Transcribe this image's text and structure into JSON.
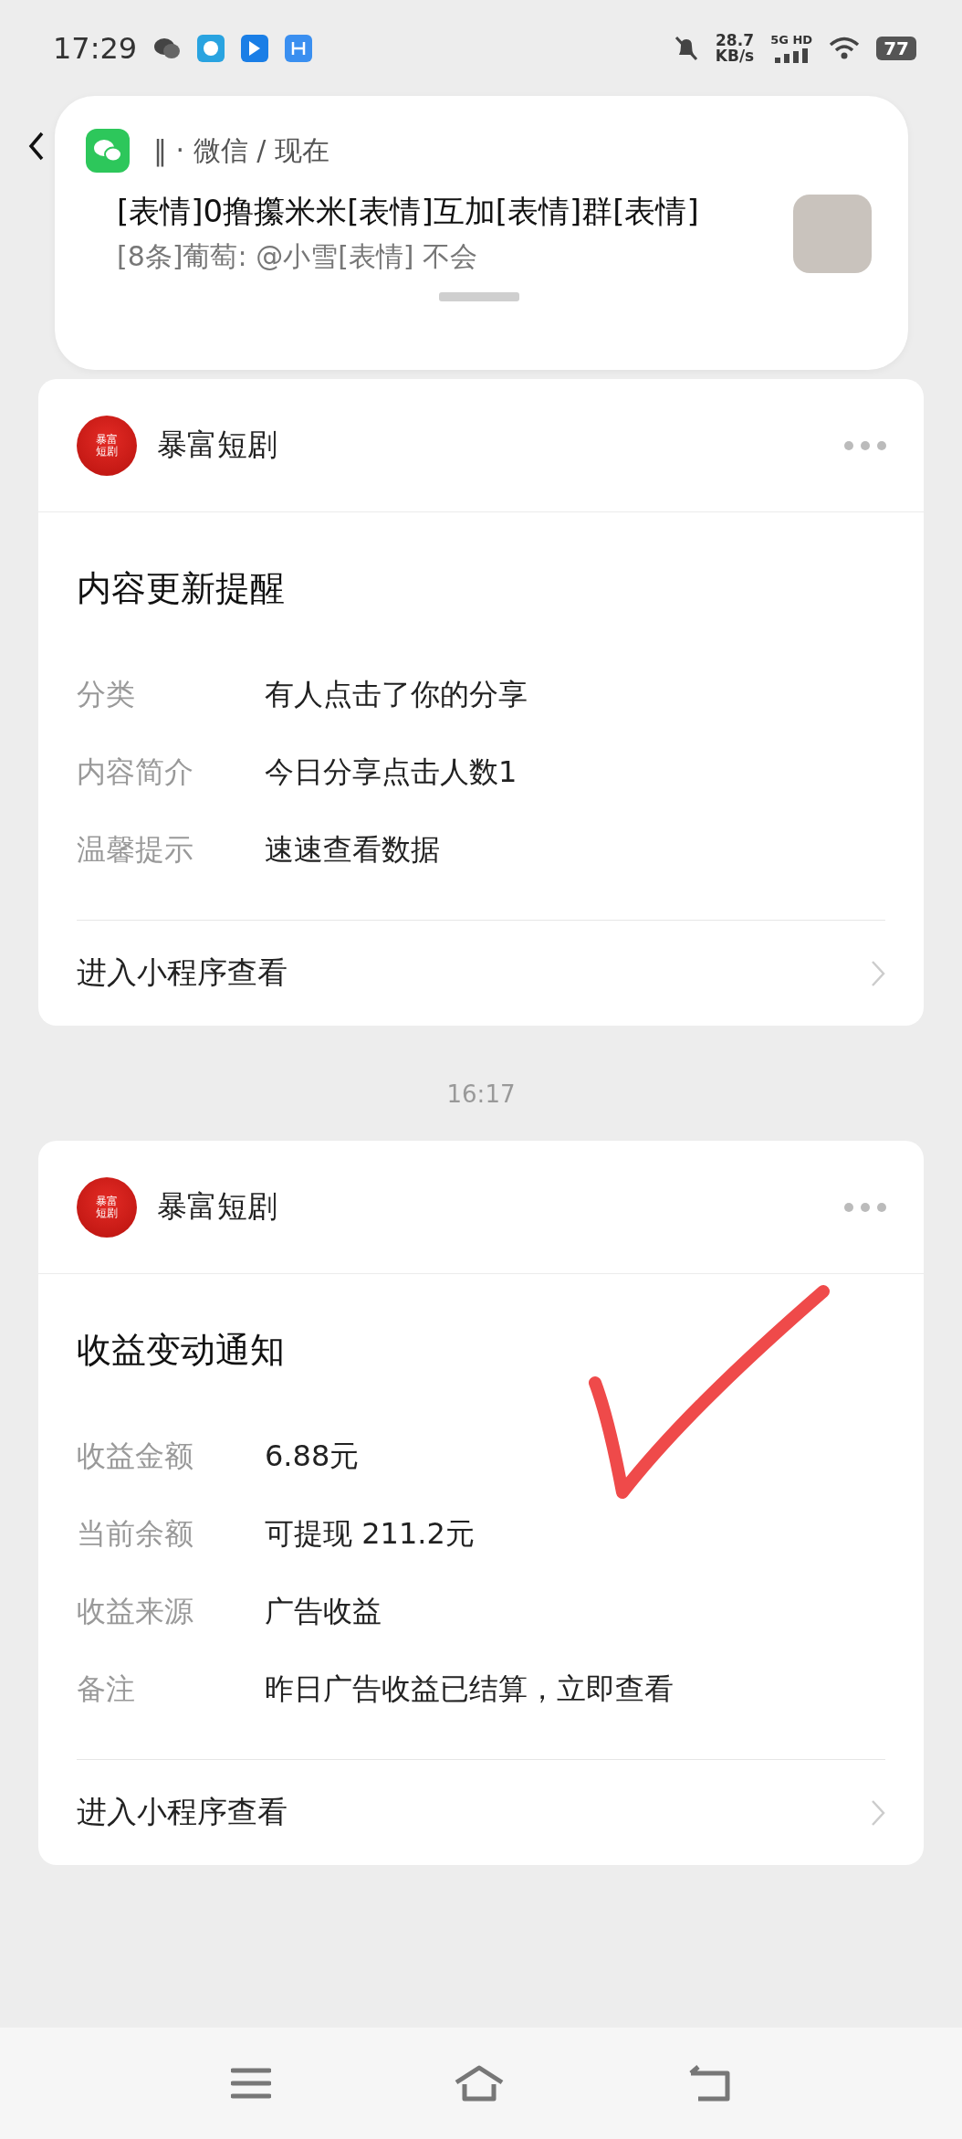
{
  "status_bar": {
    "time": "17:29",
    "speed_value": "28.7",
    "speed_unit": "KB/s",
    "network": "5G HD",
    "battery": "77"
  },
  "notification": {
    "app": "‖ · 微信 / 现在",
    "title": "[表情]0撸攥米米[表情]互加[表情]群[表情]",
    "body": "[8条]葡萄: @小雪[表情] 不会"
  },
  "messages": [
    {
      "account": "暴富短剧",
      "logo_text": "暴富短剧",
      "title": "内容更新提醒",
      "fields": [
        {
          "label": "分类",
          "value": "有人点击了你的分享"
        },
        {
          "label": "内容简介",
          "value": "今日分享点击人数1"
        },
        {
          "label": "温馨提示",
          "value": "速速查看数据"
        }
      ],
      "link": "进入小程序查看",
      "annotated": false
    },
    {
      "time": "16:17",
      "account": "暴富短剧",
      "logo_text": "暴富短剧",
      "title": "收益变动通知",
      "fields": [
        {
          "label": "收益金额",
          "value": "6.88元"
        },
        {
          "label": "当前余额",
          "value": "可提现 211.2元"
        },
        {
          "label": "收益来源",
          "value": "广告收益"
        },
        {
          "label": "备注",
          "value": "昨日广告收益已结算，立即查看"
        }
      ],
      "link": "进入小程序查看",
      "annotated": true
    }
  ]
}
